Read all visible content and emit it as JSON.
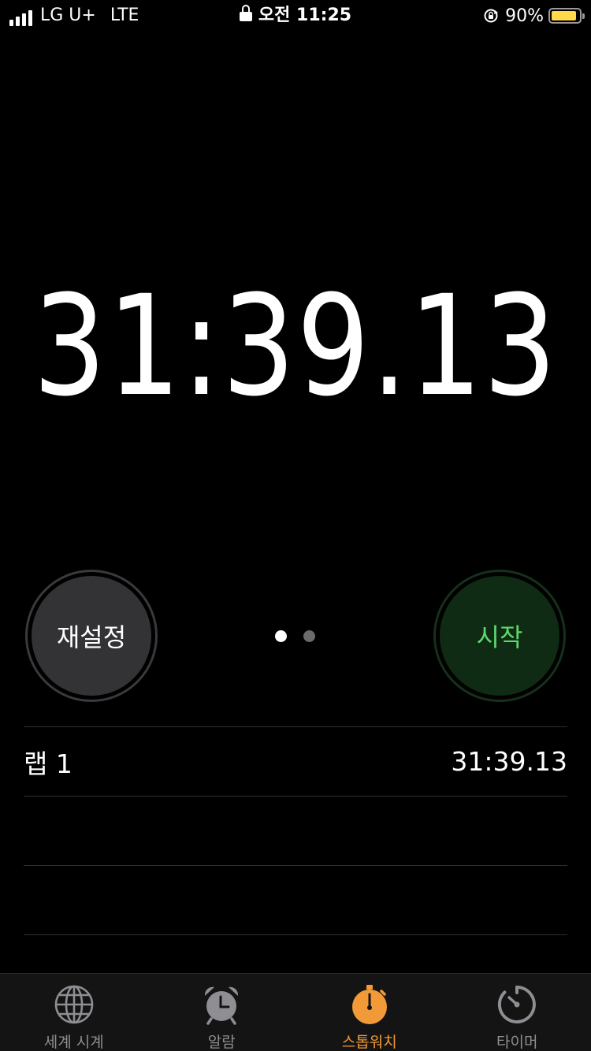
{
  "status_bar": {
    "carrier": "LG U+",
    "network": "LTE",
    "time": "오전 11:25",
    "battery_percent": "90%",
    "battery_level": 0.9,
    "battery_color": "#ffd94a"
  },
  "stopwatch": {
    "time": "31:39.13"
  },
  "buttons": {
    "reset_label": "재설정",
    "start_label": "시작"
  },
  "page_indicator": {
    "count": 2,
    "active": 0
  },
  "laps": [
    {
      "label": "랩 1",
      "time": "31:39.13"
    }
  ],
  "tabs": [
    {
      "label": "세계 시계",
      "icon": "globe-icon",
      "active": false
    },
    {
      "label": "알람",
      "icon": "alarm-clock-icon",
      "active": false
    },
    {
      "label": "스톱워치",
      "icon": "stopwatch-icon",
      "active": true
    },
    {
      "label": "타이머",
      "icon": "timer-icon",
      "active": false
    }
  ],
  "colors": {
    "accent": "#f19a37",
    "start_text": "#5bd96b",
    "start_bg": "#0f2b14",
    "reset_bg": "#333336",
    "inactive_tab": "#8e8e93"
  }
}
